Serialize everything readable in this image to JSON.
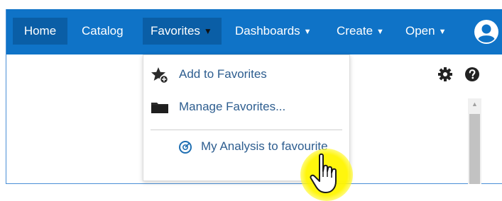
{
  "navbar": {
    "items": [
      {
        "label": "Home"
      },
      {
        "label": "Catalog"
      },
      {
        "label": "Favorites"
      },
      {
        "label": "Dashboards"
      },
      {
        "label": "Create"
      },
      {
        "label": "Open"
      }
    ],
    "caret_glyph": "▼"
  },
  "favorites_menu": {
    "items": [
      {
        "label": "Add to Favorites",
        "icon": "star-add-icon"
      },
      {
        "label": "Manage Favorites...",
        "icon": "folder-icon"
      },
      {
        "label": "My Analysis to favourite",
        "icon": "analysis-gauge-icon"
      }
    ]
  },
  "toolbar": {
    "icons": [
      "gear-icon",
      "help-icon"
    ]
  },
  "colors": {
    "navbar_bg": "#0f73c7",
    "nav_active_bg": "#0a5ea6",
    "menu_text": "#2d5d8f",
    "highlight": "#fff500"
  }
}
